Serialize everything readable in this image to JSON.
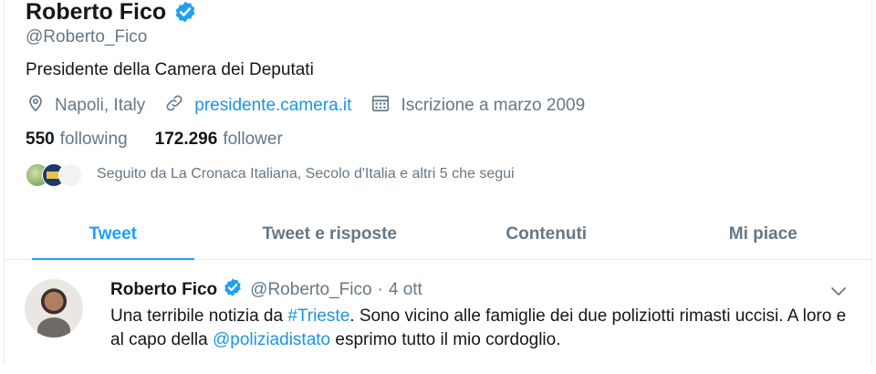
{
  "profile": {
    "name": "Roberto Fico",
    "handle": "@Roberto_Fico",
    "bio": "Presidente della Camera dei Deputati",
    "location": "Napoli, Italy",
    "website": "presidente.camera.it",
    "joined": "Iscrizione a marzo 2009",
    "following_count": "550",
    "following_label": "following",
    "followers_count": "172.296",
    "followers_label": "follower",
    "followed_by": "Seguito da La Cronaca Italiana, Secolo d'Italia e altri 5 che segui"
  },
  "tabs": [
    {
      "label": "Tweet",
      "active": true
    },
    {
      "label": "Tweet e risposte",
      "active": false
    },
    {
      "label": "Contenuti",
      "active": false
    },
    {
      "label": "Mi piace",
      "active": false
    }
  ],
  "tweet": {
    "author": "Roberto Fico",
    "handle": "@Roberto_Fico",
    "separator": "·",
    "date": "4 ott",
    "text_1": "Una terribile notizia da ",
    "hashtag": "#Trieste",
    "text_2": ". Sono vicino alle famiglie dei due poliziotti rimasti uccisi. A loro e al capo della ",
    "mention": "@poliziadistato",
    "text_3": " esprimo tutto il mio cordoglio."
  },
  "colors": {
    "accent": "#1da1f2",
    "link": "#1b95e0",
    "secondary_text": "#657786"
  },
  "icons": {
    "verified": "verified-badge-icon",
    "location": "location-pin-icon",
    "link": "link-icon",
    "calendar": "calendar-icon",
    "chevron": "chevron-down-icon"
  }
}
